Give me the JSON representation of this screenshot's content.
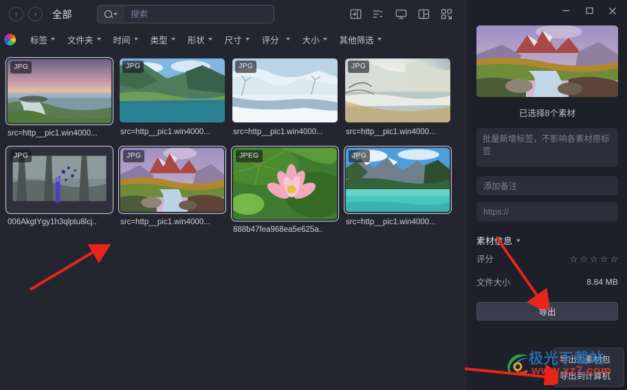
{
  "window": {
    "minimize_label": "—",
    "maximize_label": "□",
    "close_label": "×"
  },
  "topbar": {
    "back_label": "‹",
    "forward_label": "›",
    "breadcrumb": "全部",
    "search_placeholder": "搜索",
    "search_value": "",
    "icons": [
      {
        "name": "toggle-sidebar-icon"
      },
      {
        "name": "sort-icon"
      },
      {
        "name": "display-icon"
      },
      {
        "name": "layout-grid-icon"
      },
      {
        "name": "expand-grid-icon"
      }
    ]
  },
  "filters": {
    "color_wheel": "color-wheel-icon",
    "items": [
      {
        "label": "标签"
      },
      {
        "label": "文件夹"
      },
      {
        "label": "时间"
      },
      {
        "label": "类型"
      },
      {
        "label": "形状"
      },
      {
        "label": "尺寸"
      },
      {
        "label": "评分"
      },
      {
        "label": "大小"
      },
      {
        "label": "其他筛选"
      }
    ]
  },
  "grid": {
    "items": [
      {
        "badge": "JPG",
        "caption": "src=http__pic1.win4000...",
        "selected": true,
        "art": "waterfall"
      },
      {
        "badge": "JPG",
        "caption": "src=http__pic1.win4000...",
        "selected": false,
        "art": "fjord"
      },
      {
        "badge": "JPG",
        "caption": "src=http__pic1.win4000...",
        "selected": false,
        "art": "winter"
      },
      {
        "badge": "JPG",
        "caption": "src=http__pic1.win4000...",
        "selected": false,
        "art": "frost"
      },
      {
        "badge": "JPG",
        "caption": "006AkgtYgy1h3qlptu8lcj..",
        "selected": true,
        "art": "forest"
      },
      {
        "badge": "JPG",
        "caption": "src=http__pic1.win4000...",
        "selected": true,
        "art": "patagonia"
      },
      {
        "badge": "JPEG",
        "caption": "888b47fea968ea5e625a..",
        "selected": true,
        "art": "lotus"
      },
      {
        "badge": "JPG",
        "caption": "src=http__pic1.win4000...",
        "selected": true,
        "art": "lake"
      }
    ]
  },
  "sidebar": {
    "preview_art": "patagonia",
    "selection_count": "已选择8个素材",
    "tags_placeholder": "批量新增标签，不影响各素材原标签",
    "note_placeholder": "添加备注",
    "url_placeholder": "https://",
    "info_section_title": "素材信息",
    "rating_label": "评分",
    "rating_stars": "☆☆☆☆☆",
    "filesize_label": "文件大小",
    "filesize_value": "8.84 MB",
    "export_button": "导出",
    "export_menu": [
      {
        "label": "导出为素材包"
      },
      {
        "label": "导出到计算机"
      }
    ]
  },
  "watermark": {
    "line1": "极光下载站",
    "line2": "www.xz7.com"
  },
  "colors": {
    "main_bg": "#23252f",
    "side_bg": "#1d1f29",
    "accent": "#3a3e4c",
    "annotation": "#e8251a"
  }
}
